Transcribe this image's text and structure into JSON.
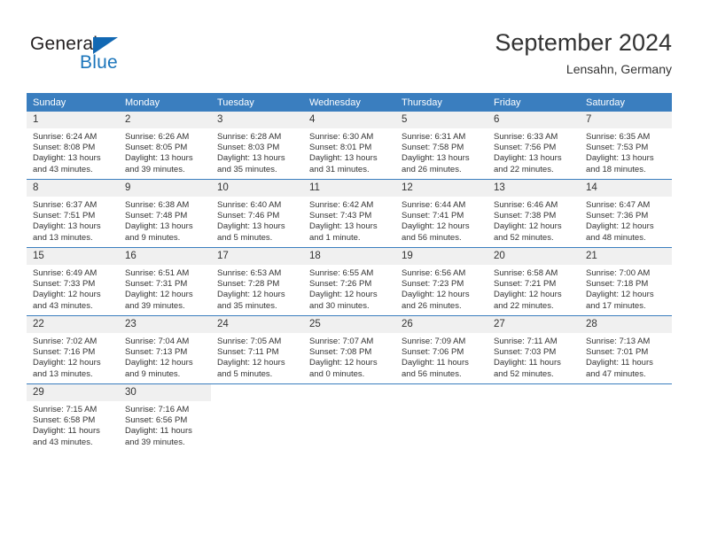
{
  "brand": {
    "name_part1": "General",
    "name_part2": "Blue",
    "triangle_color": "#1268b3",
    "blue_color": "#1b75bb"
  },
  "header": {
    "title": "September 2024",
    "subtitle": "Lensahn, Germany"
  },
  "theme": {
    "header_row_bg": "#3a7ebf",
    "daynum_bg": "#f0f0f0",
    "text": "#333333"
  },
  "weekday_headers": [
    "Sunday",
    "Monday",
    "Tuesday",
    "Wednesday",
    "Thursday",
    "Friday",
    "Saturday"
  ],
  "weeks": [
    [
      {
        "day": "1",
        "sunrise": "Sunrise: 6:24 AM",
        "sunset": "Sunset: 8:08 PM",
        "daylight1": "Daylight: 13 hours",
        "daylight2": "and 43 minutes."
      },
      {
        "day": "2",
        "sunrise": "Sunrise: 6:26 AM",
        "sunset": "Sunset: 8:05 PM",
        "daylight1": "Daylight: 13 hours",
        "daylight2": "and 39 minutes."
      },
      {
        "day": "3",
        "sunrise": "Sunrise: 6:28 AM",
        "sunset": "Sunset: 8:03 PM",
        "daylight1": "Daylight: 13 hours",
        "daylight2": "and 35 minutes."
      },
      {
        "day": "4",
        "sunrise": "Sunrise: 6:30 AM",
        "sunset": "Sunset: 8:01 PM",
        "daylight1": "Daylight: 13 hours",
        "daylight2": "and 31 minutes."
      },
      {
        "day": "5",
        "sunrise": "Sunrise: 6:31 AM",
        "sunset": "Sunset: 7:58 PM",
        "daylight1": "Daylight: 13 hours",
        "daylight2": "and 26 minutes."
      },
      {
        "day": "6",
        "sunrise": "Sunrise: 6:33 AM",
        "sunset": "Sunset: 7:56 PM",
        "daylight1": "Daylight: 13 hours",
        "daylight2": "and 22 minutes."
      },
      {
        "day": "7",
        "sunrise": "Sunrise: 6:35 AM",
        "sunset": "Sunset: 7:53 PM",
        "daylight1": "Daylight: 13 hours",
        "daylight2": "and 18 minutes."
      }
    ],
    [
      {
        "day": "8",
        "sunrise": "Sunrise: 6:37 AM",
        "sunset": "Sunset: 7:51 PM",
        "daylight1": "Daylight: 13 hours",
        "daylight2": "and 13 minutes."
      },
      {
        "day": "9",
        "sunrise": "Sunrise: 6:38 AM",
        "sunset": "Sunset: 7:48 PM",
        "daylight1": "Daylight: 13 hours",
        "daylight2": "and 9 minutes."
      },
      {
        "day": "10",
        "sunrise": "Sunrise: 6:40 AM",
        "sunset": "Sunset: 7:46 PM",
        "daylight1": "Daylight: 13 hours",
        "daylight2": "and 5 minutes."
      },
      {
        "day": "11",
        "sunrise": "Sunrise: 6:42 AM",
        "sunset": "Sunset: 7:43 PM",
        "daylight1": "Daylight: 13 hours",
        "daylight2": "and 1 minute."
      },
      {
        "day": "12",
        "sunrise": "Sunrise: 6:44 AM",
        "sunset": "Sunset: 7:41 PM",
        "daylight1": "Daylight: 12 hours",
        "daylight2": "and 56 minutes."
      },
      {
        "day": "13",
        "sunrise": "Sunrise: 6:46 AM",
        "sunset": "Sunset: 7:38 PM",
        "daylight1": "Daylight: 12 hours",
        "daylight2": "and 52 minutes."
      },
      {
        "day": "14",
        "sunrise": "Sunrise: 6:47 AM",
        "sunset": "Sunset: 7:36 PM",
        "daylight1": "Daylight: 12 hours",
        "daylight2": "and 48 minutes."
      }
    ],
    [
      {
        "day": "15",
        "sunrise": "Sunrise: 6:49 AM",
        "sunset": "Sunset: 7:33 PM",
        "daylight1": "Daylight: 12 hours",
        "daylight2": "and 43 minutes."
      },
      {
        "day": "16",
        "sunrise": "Sunrise: 6:51 AM",
        "sunset": "Sunset: 7:31 PM",
        "daylight1": "Daylight: 12 hours",
        "daylight2": "and 39 minutes."
      },
      {
        "day": "17",
        "sunrise": "Sunrise: 6:53 AM",
        "sunset": "Sunset: 7:28 PM",
        "daylight1": "Daylight: 12 hours",
        "daylight2": "and 35 minutes."
      },
      {
        "day": "18",
        "sunrise": "Sunrise: 6:55 AM",
        "sunset": "Sunset: 7:26 PM",
        "daylight1": "Daylight: 12 hours",
        "daylight2": "and 30 minutes."
      },
      {
        "day": "19",
        "sunrise": "Sunrise: 6:56 AM",
        "sunset": "Sunset: 7:23 PM",
        "daylight1": "Daylight: 12 hours",
        "daylight2": "and 26 minutes."
      },
      {
        "day": "20",
        "sunrise": "Sunrise: 6:58 AM",
        "sunset": "Sunset: 7:21 PM",
        "daylight1": "Daylight: 12 hours",
        "daylight2": "and 22 minutes."
      },
      {
        "day": "21",
        "sunrise": "Sunrise: 7:00 AM",
        "sunset": "Sunset: 7:18 PM",
        "daylight1": "Daylight: 12 hours",
        "daylight2": "and 17 minutes."
      }
    ],
    [
      {
        "day": "22",
        "sunrise": "Sunrise: 7:02 AM",
        "sunset": "Sunset: 7:16 PM",
        "daylight1": "Daylight: 12 hours",
        "daylight2": "and 13 minutes."
      },
      {
        "day": "23",
        "sunrise": "Sunrise: 7:04 AM",
        "sunset": "Sunset: 7:13 PM",
        "daylight1": "Daylight: 12 hours",
        "daylight2": "and 9 minutes."
      },
      {
        "day": "24",
        "sunrise": "Sunrise: 7:05 AM",
        "sunset": "Sunset: 7:11 PM",
        "daylight1": "Daylight: 12 hours",
        "daylight2": "and 5 minutes."
      },
      {
        "day": "25",
        "sunrise": "Sunrise: 7:07 AM",
        "sunset": "Sunset: 7:08 PM",
        "daylight1": "Daylight: 12 hours",
        "daylight2": "and 0 minutes."
      },
      {
        "day": "26",
        "sunrise": "Sunrise: 7:09 AM",
        "sunset": "Sunset: 7:06 PM",
        "daylight1": "Daylight: 11 hours",
        "daylight2": "and 56 minutes."
      },
      {
        "day": "27",
        "sunrise": "Sunrise: 7:11 AM",
        "sunset": "Sunset: 7:03 PM",
        "daylight1": "Daylight: 11 hours",
        "daylight2": "and 52 minutes."
      },
      {
        "day": "28",
        "sunrise": "Sunrise: 7:13 AM",
        "sunset": "Sunset: 7:01 PM",
        "daylight1": "Daylight: 11 hours",
        "daylight2": "and 47 minutes."
      }
    ],
    [
      {
        "day": "29",
        "sunrise": "Sunrise: 7:15 AM",
        "sunset": "Sunset: 6:58 PM",
        "daylight1": "Daylight: 11 hours",
        "daylight2": "and 43 minutes."
      },
      {
        "day": "30",
        "sunrise": "Sunrise: 7:16 AM",
        "sunset": "Sunset: 6:56 PM",
        "daylight1": "Daylight: 11 hours",
        "daylight2": "and 39 minutes."
      },
      {
        "day": "",
        "sunrise": "",
        "sunset": "",
        "daylight1": "",
        "daylight2": ""
      },
      {
        "day": "",
        "sunrise": "",
        "sunset": "",
        "daylight1": "",
        "daylight2": ""
      },
      {
        "day": "",
        "sunrise": "",
        "sunset": "",
        "daylight1": "",
        "daylight2": ""
      },
      {
        "day": "",
        "sunrise": "",
        "sunset": "",
        "daylight1": "",
        "daylight2": ""
      },
      {
        "day": "",
        "sunrise": "",
        "sunset": "",
        "daylight1": "",
        "daylight2": ""
      }
    ]
  ]
}
